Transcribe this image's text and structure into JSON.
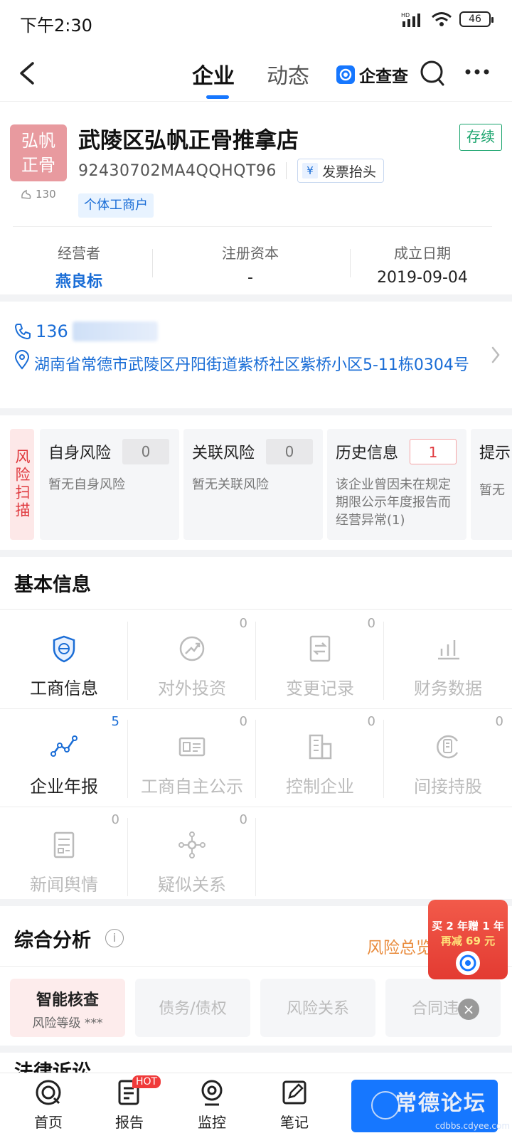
{
  "status_bar": {
    "time": "下午2:30",
    "network": "HD",
    "battery": "46"
  },
  "nav": {
    "tabs": [
      {
        "label": "企业",
        "active": true
      },
      {
        "label": "动态",
        "active": false
      }
    ],
    "brand": "企查查"
  },
  "company": {
    "logo_text_line1": "弘帆",
    "logo_text_line2": "正骨",
    "name": "武陵区弘帆正骨推拿店",
    "status": "存续",
    "credit_code": "92430702MA4QQHQT96",
    "invoice_label": "发票抬头",
    "views": "130",
    "type_tag": "个体工商户"
  },
  "stats": [
    {
      "label": "经营者",
      "value": "燕良标"
    },
    {
      "label": "注册资本",
      "value": "-"
    },
    {
      "label": "成立日期",
      "value": "2019-09-04"
    }
  ],
  "contact": {
    "phone_prefix": "136",
    "address": "湖南省常德市武陵区丹阳街道紫桥社区紫桥小区5-11栋0304号"
  },
  "risk_scan": {
    "label": "风险扫描",
    "cards": [
      {
        "title": "自身风险",
        "count": "0",
        "desc": "暂无自身风险"
      },
      {
        "title": "关联风险",
        "count": "0",
        "desc": "暂无关联风险"
      },
      {
        "title": "历史信息",
        "count": "1",
        "desc": "该企业曾因未在规定期限公示年度报告而经营异常(1)"
      },
      {
        "title": "提示",
        "desc": "暂无"
      }
    ]
  },
  "basic_info": {
    "title": "基本信息",
    "items": [
      {
        "label": "工商信息",
        "count": "",
        "icon": "shield-icon",
        "active": true
      },
      {
        "label": "对外投资",
        "count": "0",
        "icon": "investment-icon",
        "active": false
      },
      {
        "label": "变更记录",
        "count": "0",
        "icon": "change-record-icon",
        "active": false
      },
      {
        "label": "财务数据",
        "count": "",
        "icon": "bar-chart-icon",
        "active": false
      },
      {
        "label": "企业年报",
        "count": "5",
        "icon": "trend-line-icon",
        "active": true
      },
      {
        "label": "工商自主公示",
        "count": "0",
        "icon": "id-card-icon",
        "active": false
      },
      {
        "label": "控制企业",
        "count": "0",
        "icon": "building-icon",
        "active": false
      },
      {
        "label": "间接持股",
        "count": "0",
        "icon": "shareholding-icon",
        "active": false
      },
      {
        "label": "新闻舆情",
        "count": "0",
        "icon": "news-icon",
        "active": false
      },
      {
        "label": "疑似关系",
        "count": "0",
        "icon": "relation-icon",
        "active": false
      }
    ]
  },
  "analysis": {
    "title": "综合分析",
    "overview": "风险总览",
    "cards": [
      {
        "title": "智能核查",
        "sub": "风险等级 ***",
        "active": true
      },
      {
        "title": "债务/债权",
        "sub": "",
        "active": false
      },
      {
        "title": "风险关系",
        "sub": "",
        "active": false
      },
      {
        "title": "合同违约",
        "sub": "",
        "active": false
      }
    ]
  },
  "next_section_peek": "法律诉讼",
  "promo": {
    "line1": "买 2 年赠 1 年",
    "line2": "再减 69 元"
  },
  "bottom_nav": {
    "items": [
      {
        "label": "首页"
      },
      {
        "label": "报告"
      },
      {
        "label": "监控"
      },
      {
        "label": "笔记"
      }
    ],
    "hot_badge": "HOT"
  },
  "watermark": {
    "title": "常德论坛",
    "url": "cdbbs.cdyee.com"
  },
  "colors": {
    "accent": "#1677ff",
    "link": "#1a6dd6",
    "danger": "#e0393e",
    "success": "#17a36b",
    "warning": "#e98c3e"
  }
}
